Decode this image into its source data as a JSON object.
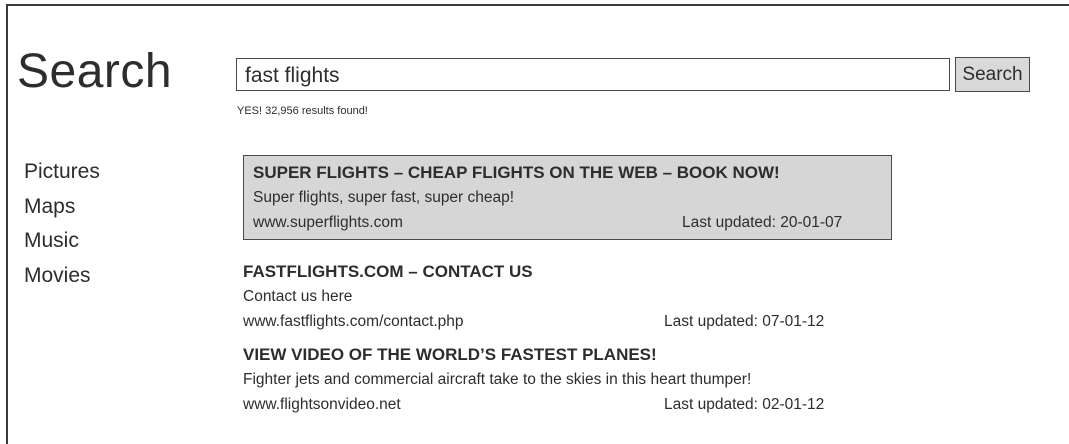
{
  "header": {
    "title": "Search"
  },
  "search": {
    "query": "fast flights",
    "button_label": "Search",
    "results_count_text": "YES! 32,956 results found!"
  },
  "sidebar": {
    "items": [
      {
        "label": "Pictures"
      },
      {
        "label": "Maps"
      },
      {
        "label": "Music"
      },
      {
        "label": "Movies"
      }
    ]
  },
  "results": [
    {
      "title": "SUPER FLIGHTS – CHEAP FLIGHTS ON THE WEB – BOOK NOW!",
      "description": "Super flights, super fast, super cheap!",
      "url": "www.superflights.com",
      "updated": "Last updated: 20-01-07",
      "featured": true
    },
    {
      "title": "FASTFLIGHTS.COM – CONTACT US",
      "description": "Contact us here",
      "url": "www.fastflights.com/contact.php",
      "updated": "Last updated: 07-01-12",
      "featured": false
    },
    {
      "title": "VIEW VIDEO OF THE WORLD’S  FASTEST PLANES!",
      "description": "Fighter jets and commercial aircraft take to the skies in this heart thumper!",
      "url": "www.flightsonvideo.net",
      "updated": "Last updated: 02-01-12",
      "featured": false
    }
  ],
  "colors": {
    "featured_background": "#d6d6d6",
    "button_background": "#d9d9d9",
    "text": "#2d2d2d",
    "border": "#4a4a4a"
  }
}
